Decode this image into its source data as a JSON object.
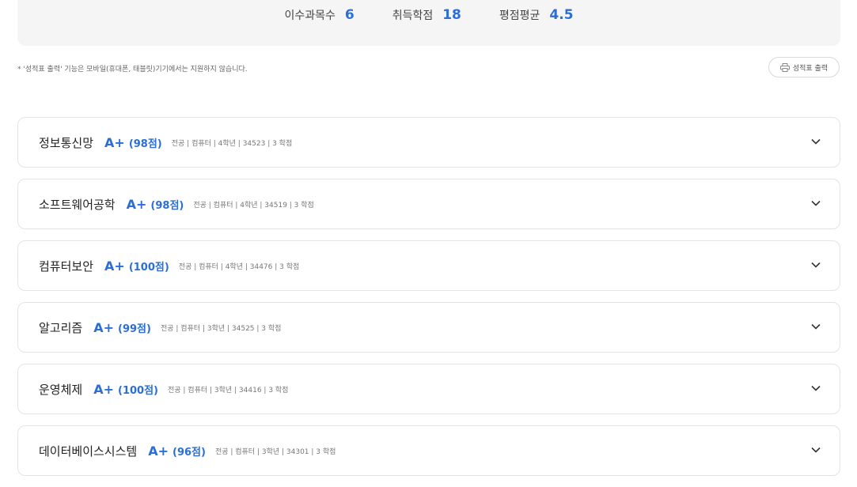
{
  "summary": {
    "courses_label": "이수과목수",
    "courses_value": "6",
    "credits_label": "취득학점",
    "credits_value": "18",
    "gpa_label": "평점평균",
    "gpa_value": "4.5"
  },
  "notice": "* '성적표 출력' 기능은 모바일(휴대폰, 태블릿)기기에서는 지원하지 않습니다.",
  "print_button": {
    "label": "성적표 출력",
    "icon": "printer-icon"
  },
  "courses": [
    {
      "name": "정보통신망",
      "grade": "A+",
      "score": "(98점)",
      "meta": "전공 | 컴퓨터 | 4학년 | 34523 | 3 학점"
    },
    {
      "name": "소프트웨어공학",
      "grade": "A+",
      "score": "(98점)",
      "meta": "전공 | 컴퓨터 | 4학년 | 34519 | 3 학점"
    },
    {
      "name": "컴퓨터보안",
      "grade": "A+",
      "score": "(100점)",
      "meta": "전공 | 컴퓨터 | 4학년 | 34476 | 3 학점"
    },
    {
      "name": "알고리즘",
      "grade": "A+",
      "score": "(99점)",
      "meta": "전공 | 컴퓨터 | 3학년 | 34525 | 3 학점"
    },
    {
      "name": "운영체제",
      "grade": "A+",
      "score": "(100점)",
      "meta": "전공 | 컴퓨터 | 3학년 | 34416 | 3 학점"
    },
    {
      "name": "데이터베이스시스템",
      "grade": "A+",
      "score": "(96점)",
      "meta": "전공 | 컴퓨터 | 3학년 | 34301 | 3 학점"
    }
  ],
  "colors": {
    "accent": "#2b6fd6",
    "summary_bg": "#f5f5f6",
    "card_border": "#e4e4e4"
  }
}
